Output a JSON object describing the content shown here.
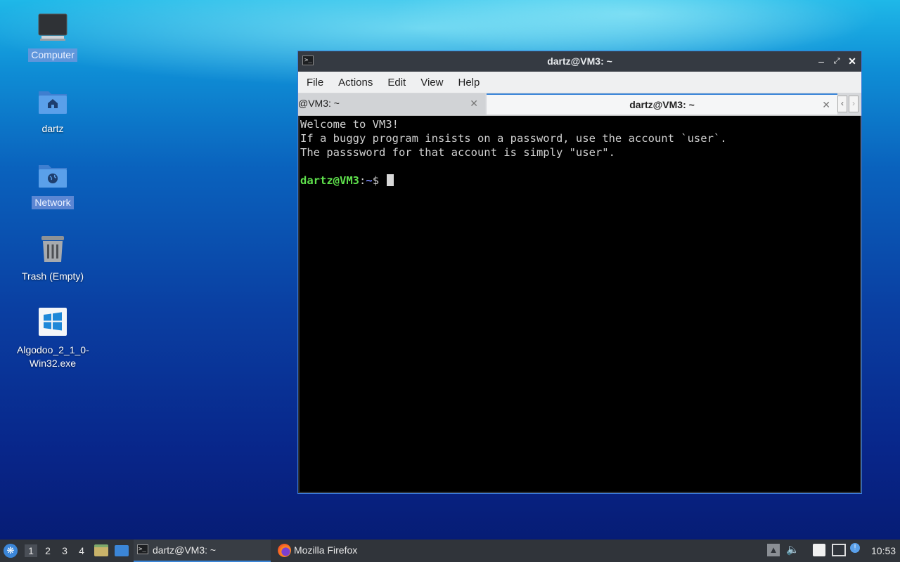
{
  "desktop": {
    "icons": [
      {
        "label": "Computer",
        "icon": "monitor-icon"
      },
      {
        "label": "dartz",
        "icon": "home-folder-icon"
      },
      {
        "label": "Network",
        "icon": "network-folder-icon"
      },
      {
        "label": "Trash (Empty)",
        "icon": "trash-icon"
      },
      {
        "label": "Algodoo_2_1_0-",
        "label2": "Win32.exe",
        "icon": "windows-exe-icon"
      }
    ]
  },
  "terminal": {
    "title": "dartz@VM3: ~",
    "menu": [
      "File",
      "Actions",
      "Edit",
      "View",
      "Help"
    ],
    "tabs": [
      {
        "label": "@VM3: ~",
        "active": false
      },
      {
        "label": "dartz@VM3: ~",
        "active": true
      }
    ],
    "lines": [
      "Welcome to VM3!",
      "If a buggy program insists on a password, use the account `user`.",
      "The passsword for that account is simply \"user\"."
    ],
    "prompt": {
      "user_host": "dartz@VM3",
      "sep": ":",
      "path": "~",
      "symbol": "$"
    }
  },
  "taskbar": {
    "workspaces": [
      "1",
      "2",
      "3",
      "4"
    ],
    "tasks": [
      {
        "label": "dartz@VM3: ~",
        "icon": "terminal-icon",
        "active": true
      },
      {
        "label": "Mozilla Firefox",
        "icon": "firefox-icon",
        "active": false
      }
    ],
    "clock": "10:53"
  },
  "colors": {
    "accent": "#3b86d8",
    "prompt_user": "#5fe14c",
    "prompt_path": "#7b8bff"
  }
}
